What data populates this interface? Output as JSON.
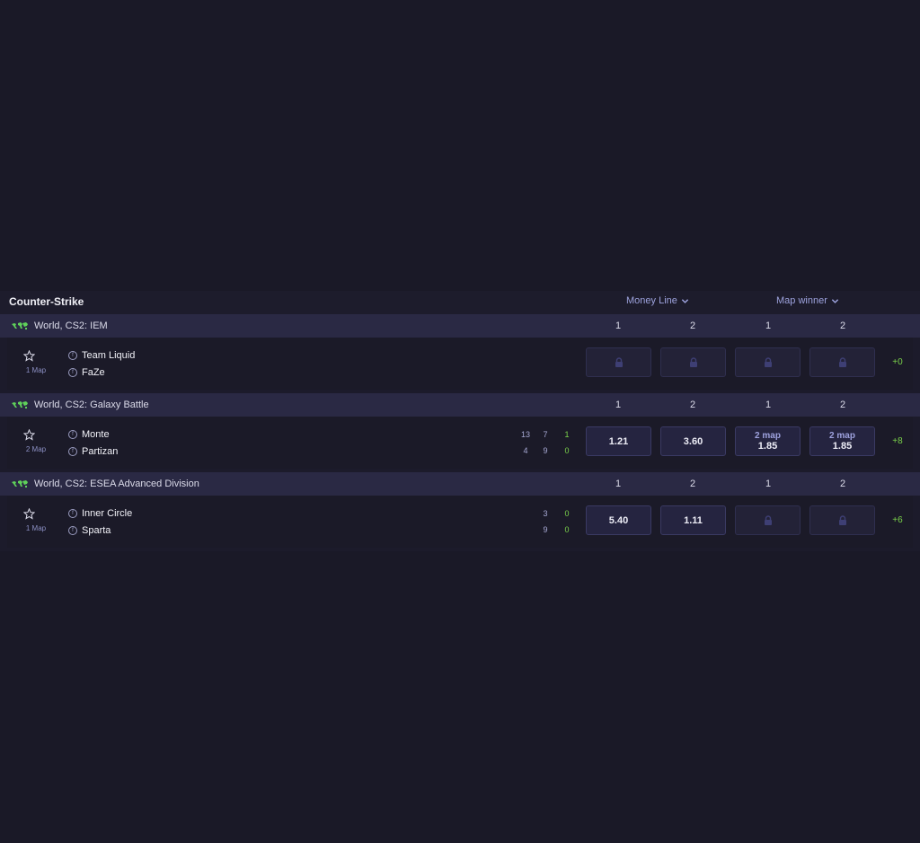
{
  "sport": {
    "title": "Counter-Strike"
  },
  "markets": [
    {
      "label": "Money Line",
      "icon": "chevron-down-icon"
    },
    {
      "label": "Map winner",
      "icon": "chevron-down-icon"
    }
  ],
  "colors": {
    "accent": "#9da2dd",
    "positive": "#7bd34b",
    "league_bar": "#2a2944"
  },
  "leagues": [
    {
      "name": "World, CS2: IEM",
      "columns": [
        "1",
        "2",
        "1",
        "2"
      ],
      "match": {
        "maps": "1 Map",
        "teams": [
          "Team Liquid",
          "FaZe"
        ],
        "scores": [],
        "odds": [
          {
            "locked": true,
            "icon": "lock-icon"
          },
          {
            "locked": true,
            "icon": "lock-icon"
          },
          {
            "locked": true,
            "icon": "lock-icon"
          },
          {
            "locked": true,
            "icon": "lock-icon"
          }
        ],
        "more": "+0"
      }
    },
    {
      "name": "World, CS2: Galaxy Battle",
      "columns": [
        "1",
        "2",
        "1",
        "2"
      ],
      "match": {
        "maps": "2 Map",
        "teams": [
          "Monte",
          "Partizan"
        ],
        "scores": [
          [
            "13",
            "7",
            "1"
          ],
          [
            "4",
            "9",
            "0"
          ]
        ],
        "odds": [
          {
            "value": "1.21"
          },
          {
            "value": "3.60"
          },
          {
            "sub": "2 map",
            "value": "1.85"
          },
          {
            "sub": "2 map",
            "value": "1.85"
          }
        ],
        "more": "+8"
      }
    },
    {
      "name": "World, CS2: ESEA Advanced Division",
      "columns": [
        "1",
        "2",
        "1",
        "2"
      ],
      "match": {
        "maps": "1 Map",
        "teams": [
          "Inner Circle",
          "Sparta"
        ],
        "scores": [
          [
            "3",
            "0"
          ],
          [
            "9",
            "0"
          ]
        ],
        "odds": [
          {
            "value": "5.40"
          },
          {
            "value": "1.11"
          },
          {
            "locked": true,
            "icon": "lock-icon"
          },
          {
            "locked": true,
            "icon": "lock-icon"
          }
        ],
        "more": "+6"
      }
    }
  ]
}
